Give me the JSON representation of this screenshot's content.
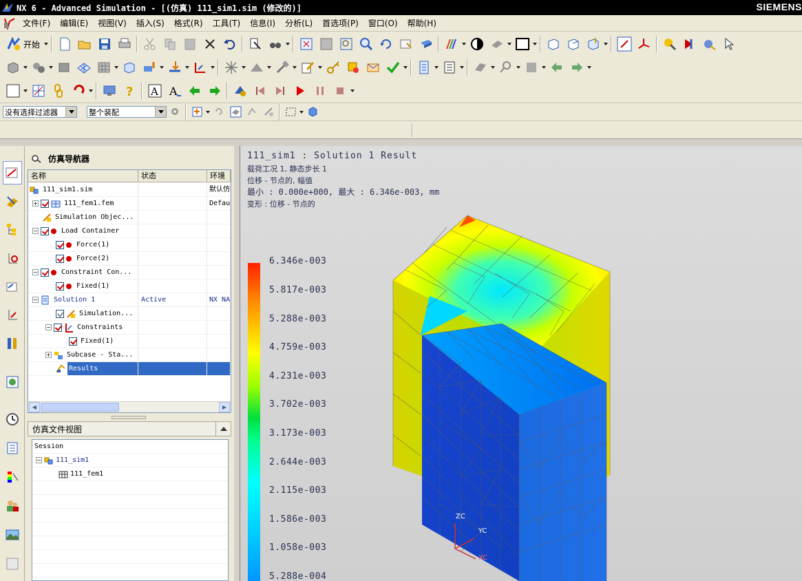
{
  "window": {
    "title": "NX 6 - Advanced Simulation - [(仿真) 111_sim1.sim (修改的)]",
    "brand": "SIEMENS"
  },
  "menu": [
    "文件(F)",
    "编辑(E)",
    "视图(V)",
    "插入(S)",
    "格式(R)",
    "工具(T)",
    "信息(I)",
    "分析(L)",
    "首选项(P)",
    "窗口(O)",
    "帮助(H)"
  ],
  "toolbar": {
    "start_label": "开始"
  },
  "filter": {
    "selection_filter": "没有选择过滤器",
    "assembly_scope": "整个装配"
  },
  "navigator": {
    "title": "仿真导航器",
    "columns": [
      "名称",
      "状态",
      "环境"
    ],
    "rows": [
      {
        "name": "111_sim1.sim",
        "status": "",
        "env": "默认仿真"
      },
      {
        "name": "111_fem1.fem",
        "status": "",
        "env": "Default"
      },
      {
        "name": "Simulation Objec...",
        "status": "",
        "env": ""
      },
      {
        "name": "Load Container",
        "status": "",
        "env": ""
      },
      {
        "name": "Force(1)",
        "status": "",
        "env": ""
      },
      {
        "name": "Force(2)",
        "status": "",
        "env": ""
      },
      {
        "name": "Constraint Con...",
        "status": "",
        "env": ""
      },
      {
        "name": "Fixed(1)",
        "status": "",
        "env": ""
      },
      {
        "name": "Solution 1",
        "status": "Active",
        "env": "NX NASTRAN"
      },
      {
        "name": "Simulation...",
        "status": "",
        "env": ""
      },
      {
        "name": "Constraints",
        "status": "",
        "env": ""
      },
      {
        "name": "Fixed(1)",
        "status": "",
        "env": ""
      },
      {
        "name": "Subcase - Sta...",
        "status": "",
        "env": ""
      },
      {
        "name": "Results",
        "status": "",
        "env": ""
      }
    ]
  },
  "file_view": {
    "title": "仿真文件视图",
    "rows": [
      "Session",
      "111_sim1",
      "111_fem1"
    ]
  },
  "graphics": {
    "header": "111_sim1 : Solution 1 Result",
    "line1": "载荷工况 1, 静态步长 1",
    "line2": "位移 - 节点的, 幅值",
    "line3": "最小 :  0.000e+000, 最大 :  6.346e-003, mm",
    "line4": "变形 : 位移 - 节点的",
    "legend": [
      "6.346e-003",
      "5.817e-003",
      "5.288e-003",
      "4.759e-003",
      "4.231e-003",
      "3.702e-003",
      "3.173e-003",
      "2.644e-003",
      "2.115e-003",
      "1.586e-003",
      "1.058e-003",
      "5.288e-004"
    ],
    "axes": {
      "zc": "ZC",
      "yc": "YC",
      "xc": "XC"
    }
  }
}
